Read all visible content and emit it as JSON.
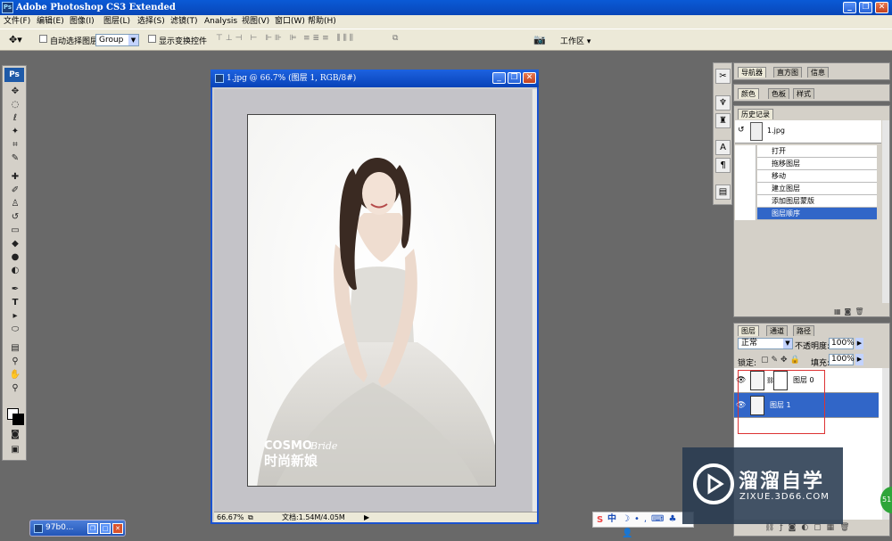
{
  "app": {
    "title": "Adobe Photoshop CS3 Extended",
    "ps_label": "Ps"
  },
  "window_buttons": {
    "min": "_",
    "max": "❐",
    "close": "✕"
  },
  "menu": [
    "文件(F)",
    "编辑(E)",
    "图像(I)",
    "图层(L)",
    "选择(S)",
    "滤镜(T)",
    "Analysis",
    "视图(V)",
    "窗口(W)",
    "帮助(H)"
  ],
  "options": {
    "auto_select_label": "自动选择图层",
    "auto_select_value": "Group",
    "show_transform_label": "显示变换控件",
    "workspace_label": "工作区 ▾"
  },
  "document": {
    "title": "1.jpg @ 66.7% (图层 1, RGB/8#)",
    "zoom": "66.67%",
    "doc_size": "文档:1.54M/4.05M",
    "photo_text_brand": "COSMO",
    "photo_text_script": "Bride",
    "photo_text_cn": "时尚新娘"
  },
  "panels": {
    "navigator_tabs": [
      "导航器",
      "直方图",
      "信息"
    ],
    "color_tabs": [
      "颜色",
      "色板",
      "样式"
    ],
    "history_tab": "历史记录",
    "history_snapshot": "1.jpg",
    "history_items": [
      "打开",
      "拖移图层",
      "移动",
      "建立图层",
      "添加图层蒙版",
      "图层顺序"
    ],
    "history_selected_index": 5,
    "layers_tabs": [
      "图层",
      "通道",
      "路径"
    ],
    "blend_mode": "正常",
    "opacity_label": "不透明度:",
    "opacity_value": "100%",
    "lock_label": "锁定:",
    "fill_label": "填充:",
    "fill_value": "100%",
    "layers": [
      {
        "name": "图层 0",
        "has_mask": true,
        "selected": false
      },
      {
        "name": "图层 1",
        "has_mask": false,
        "selected": true
      }
    ]
  },
  "taskbar": {
    "minimized_doc": "97b0..."
  },
  "ime": {
    "label": "中"
  },
  "watermark": {
    "main": "溜溜自学",
    "sub": "ZIXUE.3D66.COM"
  },
  "floating_button": "51",
  "colors": {
    "title_blue": "#0a5ad6",
    "selection_blue": "#3166c8",
    "workspace_gray": "#696969",
    "panel_bg": "#d4d0c8"
  }
}
